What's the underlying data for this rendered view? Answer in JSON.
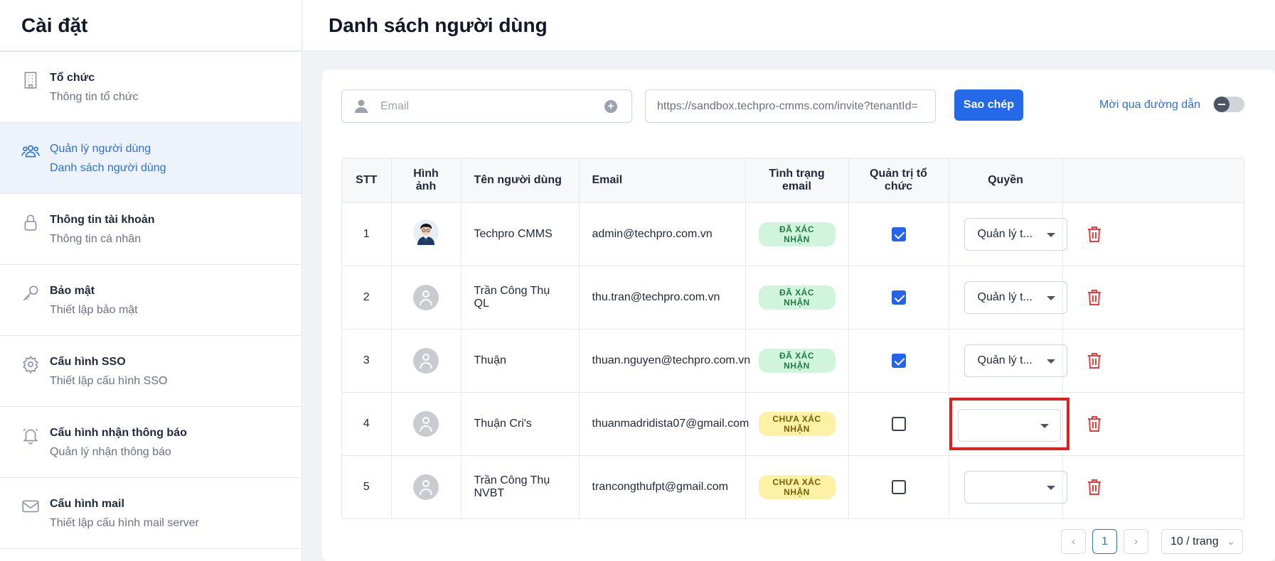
{
  "sidebar": {
    "title": "Cài đặt",
    "items": [
      {
        "label": "Tổ chức",
        "sub": "Thông tin tổ chức",
        "icon": "building-icon"
      },
      {
        "label": "Quản lý người dùng",
        "sub": "Danh sách người dùng",
        "icon": "users-icon"
      },
      {
        "label": "Thông tin tài khoản",
        "sub": "Thông tin cá nhân",
        "icon": "lock-icon"
      },
      {
        "label": "Bảo mật",
        "sub": "Thiết lập bảo mật",
        "icon": "key-icon"
      },
      {
        "label": "Cấu hình SSO",
        "sub": "Thiết lập cấu hình SSO",
        "icon": "gear-icon"
      },
      {
        "label": "Cấu hình nhận thông báo",
        "sub": "Quản lý nhận thông báo",
        "icon": "bell-icon"
      },
      {
        "label": "Cấu hình mail",
        "sub": "Thiết lập cấu hình mail server",
        "icon": "mail-icon"
      }
    ]
  },
  "header": {
    "title": "Danh sách người dùng"
  },
  "invite": {
    "email_placeholder": "Email",
    "link_value": "https://sandbox.techpro-cmms.com/invite?tenantId=",
    "copy_label": "Sao chép",
    "toggle_label": "Mời qua đường dẫn",
    "toggle_on": false
  },
  "table": {
    "headers": {
      "stt": "STT",
      "image": "Hình ảnh",
      "name": "Tên người dùng",
      "email": "Email",
      "status": "Tình trạng email",
      "admin": "Quản trị tổ chức",
      "role": "Quyền"
    },
    "rows": [
      {
        "stt": "1",
        "name": "Techpro CMMS",
        "email": "admin@techpro.com.vn",
        "status": "ĐÃ XÁC NHẬN",
        "status_type": "ok",
        "admin": true,
        "role": "Quản lý t...",
        "avatar": "cartoon-avatar"
      },
      {
        "stt": "2",
        "name": "Trần Công Thụ QL",
        "email": "thu.tran@techpro.com.vn",
        "status": "ĐÃ XÁC NHẬN",
        "status_type": "ok",
        "admin": true,
        "role": "Quản lý t...",
        "avatar": "default-avatar"
      },
      {
        "stt": "3",
        "name": "Thuận",
        "email": "thuan.nguyen@techpro.com.vn",
        "status": "ĐÃ XÁC NHẬN",
        "status_type": "ok",
        "admin": true,
        "role": "Quản lý t...",
        "avatar": "default-avatar"
      },
      {
        "stt": "4",
        "name": "Thuận Cri's",
        "email": "thuanmadridista07@gmail.com",
        "status": "CHƯA XÁC NHẬN",
        "status_type": "pending",
        "admin": false,
        "role": "",
        "avatar": "default-avatar",
        "highlighted": true
      },
      {
        "stt": "5",
        "name": "Trần Công Thụ NVBT",
        "email": "trancongthufpt@gmail.com",
        "status": "CHƯA XÁC NHẬN",
        "status_type": "pending",
        "admin": false,
        "role": "",
        "avatar": "default-avatar"
      }
    ]
  },
  "pagination": {
    "current": "1",
    "page_size": "10 / trang",
    "prev": "‹",
    "next": "›",
    "chevron": "⌄"
  },
  "colors": {
    "accent": "#2469e8",
    "highlight": "#e02020",
    "delete": "#e53e3e"
  }
}
